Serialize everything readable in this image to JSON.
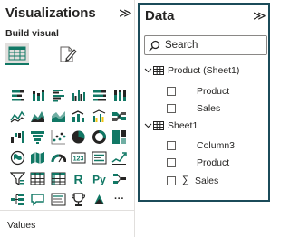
{
  "visualizations": {
    "title": "Visualizations",
    "collapse_glyph": "≫",
    "build_label": "Build visual",
    "values_label": "Values",
    "tabs": [
      {
        "name": "build-visual-tab-icon",
        "selected": true
      },
      {
        "name": "format-visual-tab-icon",
        "selected": false
      }
    ],
    "visual_icons": [
      "stacked-bar-chart",
      "stacked-column-chart",
      "clustered-bar-chart",
      "clustered-column-chart",
      "100-percent-stacked-bar-chart",
      "100-percent-stacked-column-chart",
      "line-chart",
      "area-chart",
      "stacked-area-chart",
      "line-and-column-chart",
      "line-and-clustered-column-chart",
      "ribbon-chart",
      "waterfall-chart",
      "funnel-chart",
      "scatter-chart",
      "pie-chart",
      "donut-chart",
      "treemap",
      "map",
      "filled-map",
      "gauge",
      "card",
      "multi-row-card",
      "kpi",
      "slicer",
      "table",
      "matrix",
      "r-visual",
      "python-visual",
      "key-influencers",
      "decomposition-tree",
      "qa-visual",
      "smart-narrative",
      "paginated-report",
      "power-apps",
      "more-visuals"
    ],
    "r_glyph": "R",
    "py_glyph": "Py",
    "more_glyph": "···",
    "accent_color": "#117865"
  },
  "data_pane": {
    "title": "Data",
    "collapse_glyph": "≫",
    "search": {
      "placeholder": "Search",
      "value": ""
    },
    "border_color": "#1b4b59",
    "tables": [
      {
        "name": "Product (Sheet1)",
        "expanded": true,
        "fields": [
          {
            "label": "Product",
            "checked": false,
            "measure": false
          },
          {
            "label": "Sales",
            "checked": false,
            "measure": false
          }
        ]
      },
      {
        "name": "Sheet1",
        "expanded": true,
        "fields": [
          {
            "label": "Column3",
            "checked": false,
            "measure": false
          },
          {
            "label": "Product",
            "checked": false,
            "measure": false
          },
          {
            "label": "Sales",
            "checked": false,
            "measure": true
          }
        ]
      }
    ],
    "sigma_glyph": "∑"
  }
}
